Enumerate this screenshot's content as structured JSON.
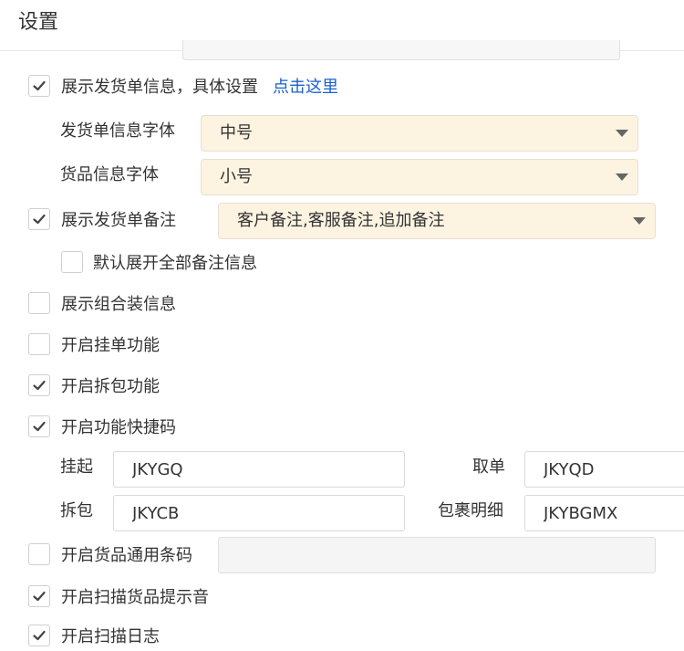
{
  "header": {
    "title": "设置"
  },
  "settings": {
    "show_order_info": {
      "label": "展示发货单信息，具体设置",
      "link": "点击这里",
      "checked": true
    },
    "order_info_font": {
      "label": "发货单信息字体",
      "value": "中号"
    },
    "goods_info_font": {
      "label": "货品信息字体",
      "value": "小号"
    },
    "show_order_remark": {
      "label": "展示发货单备注",
      "checked": true,
      "value": "客户备注,客服备注,追加备注"
    },
    "expand_all_remarks": {
      "label": "默认展开全部备注信息",
      "checked": false
    },
    "show_combo": {
      "label": "展示组合装信息",
      "checked": false
    },
    "hang_order": {
      "label": "开启挂单功能",
      "checked": false
    },
    "unpack": {
      "label": "开启拆包功能",
      "checked": true
    },
    "shortcut": {
      "label": "开启功能快捷码",
      "checked": true
    },
    "shortcuts": {
      "hang": {
        "label": "挂起",
        "value": "JKYGQ"
      },
      "take": {
        "label": "取单",
        "value": "JKYQD"
      },
      "unpack": {
        "label": "拆包",
        "value": "JKYCB"
      },
      "detail": {
        "label": "包裹明细",
        "value": "JKYBGMX"
      }
    },
    "universal_barcode": {
      "label": "开启货品通用条码",
      "checked": false,
      "value": ""
    },
    "scan_sound": {
      "label": "开启扫描货品提示音",
      "checked": true
    },
    "scan_log": {
      "label": "开启扫描日志",
      "checked": true
    }
  }
}
